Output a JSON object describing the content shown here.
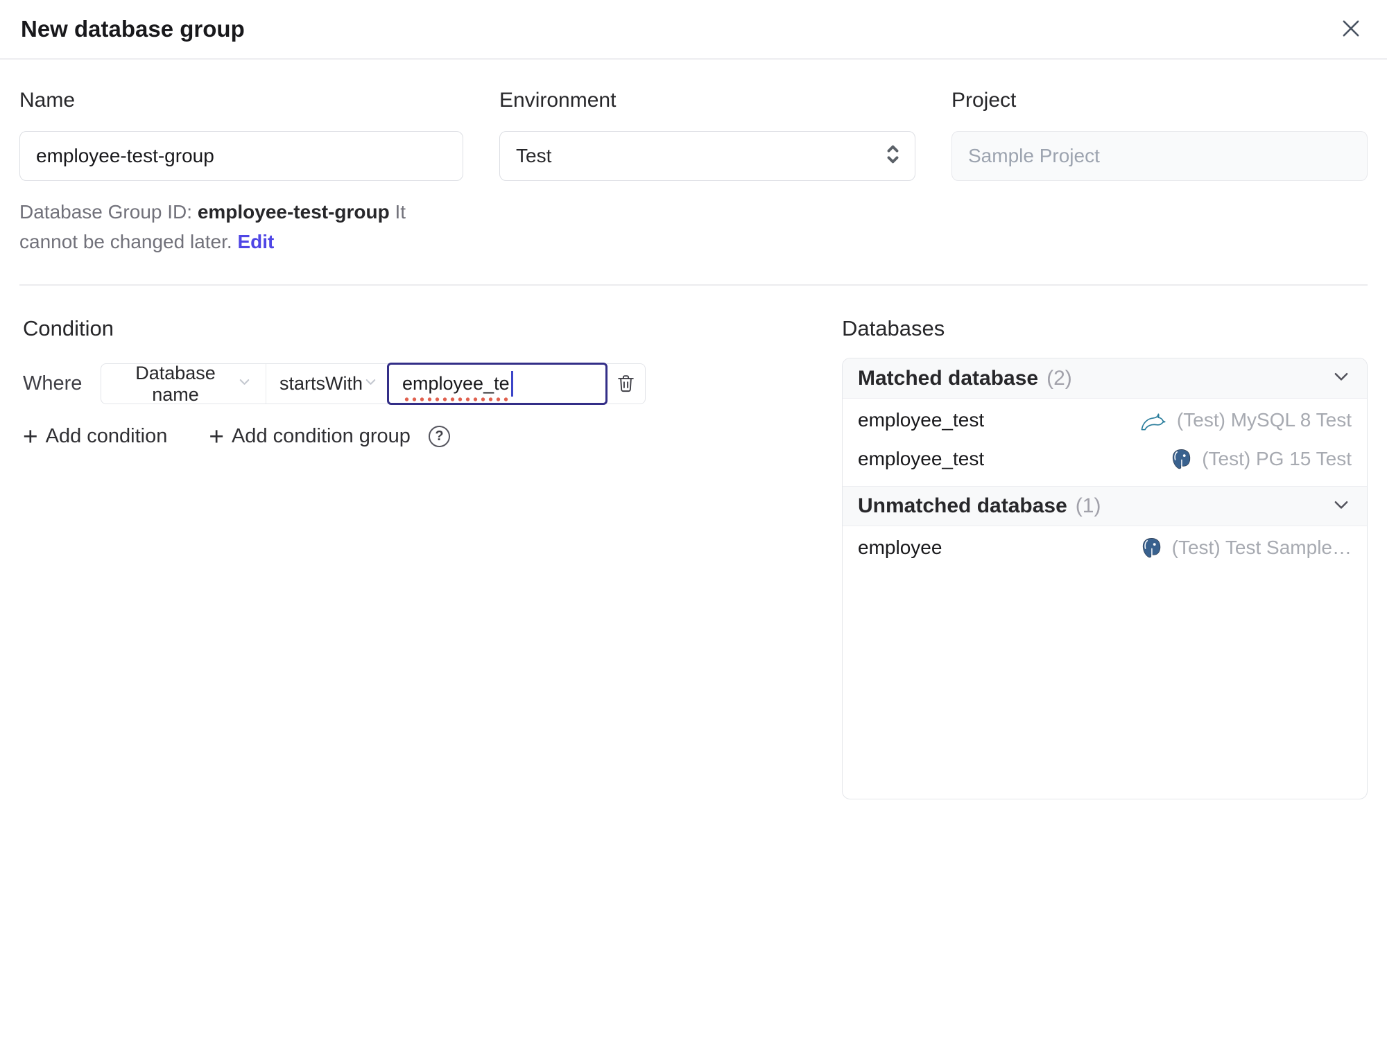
{
  "dialog": {
    "title": "New database group"
  },
  "icons": {
    "plus": "+",
    "help": "?"
  },
  "form": {
    "name_label": "Name",
    "name_value": "employee-test-group",
    "environment_label": "Environment",
    "environment_value": "Test",
    "project_label": "Project",
    "project_value": "Sample Project",
    "group_id": {
      "prefix": "Database Group ID:",
      "value": "employee-test-group",
      "note": "It cannot be changed later.",
      "edit": "Edit"
    }
  },
  "condition": {
    "heading": "Condition",
    "where": "Where",
    "field": "Database name",
    "operator": "startsWith",
    "value": "employee_te",
    "add_condition": "Add condition",
    "add_condition_group": "Add condition group"
  },
  "databases": {
    "heading": "Databases",
    "matched": {
      "title": "Matched database",
      "count": "(2)",
      "rows": [
        {
          "name": "employee_test",
          "engine": "mysql",
          "instance": "(Test) MySQL 8 Test"
        },
        {
          "name": "employee_test",
          "engine": "postgres",
          "instance": "(Test) PG 15 Test"
        }
      ]
    },
    "unmatched": {
      "title": "Unmatched database",
      "count": "(1)",
      "rows": [
        {
          "name": "employee",
          "engine": "postgres",
          "instance": "(Test) Test Sample…"
        }
      ]
    }
  },
  "colors": {
    "accent": "#4f46e5",
    "focus_border": "#332e87",
    "spellcheck": "#e0604e",
    "panel_header_bg": "#f8f9fa",
    "border": "#e4e6ea",
    "muted_text": "#a1a1aa",
    "mysql": "#2a7d9c",
    "postgres": "#39618e"
  }
}
